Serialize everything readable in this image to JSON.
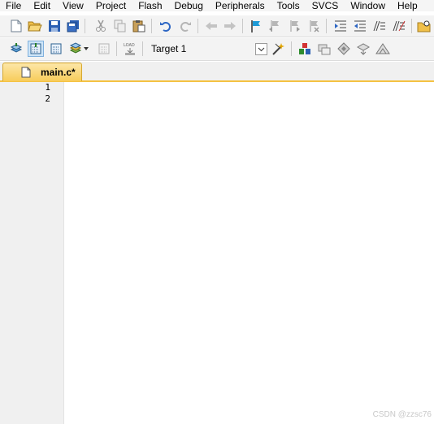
{
  "menu": [
    "File",
    "Edit",
    "View",
    "Project",
    "Flash",
    "Debug",
    "Peripherals",
    "Tools",
    "SVCS",
    "Window",
    "Help"
  ],
  "toolbar1": {
    "icons": [
      "new-file",
      "open-folder",
      "save",
      "save-all",
      "cut",
      "copy",
      "paste",
      "undo",
      "redo",
      "back",
      "forward",
      "bookmark",
      "prev-bookmark",
      "next-bookmark",
      "clear-bookmarks",
      "indent",
      "unindent",
      "comment",
      "uncomment",
      "find-in-files"
    ]
  },
  "toolbar2": {
    "icons": [
      "translate",
      "build",
      "rebuild",
      "batch-build",
      "stop-build",
      "download",
      "options-for-target",
      "manage-project-items",
      "select-packs",
      "manage-rte",
      "pack-installer",
      "event-recorder"
    ],
    "target": "Target 1"
  },
  "tabs": [
    {
      "label": "main.c*",
      "active": true
    }
  ],
  "editor": {
    "line_numbers": [
      "1",
      "2"
    ]
  },
  "watermark": "CSDN @zzsc76",
  "colors": {
    "tab_accent": "#f5c242",
    "gutter": "#f0f0f0",
    "toolbar_bg": "#f3f3f3"
  }
}
